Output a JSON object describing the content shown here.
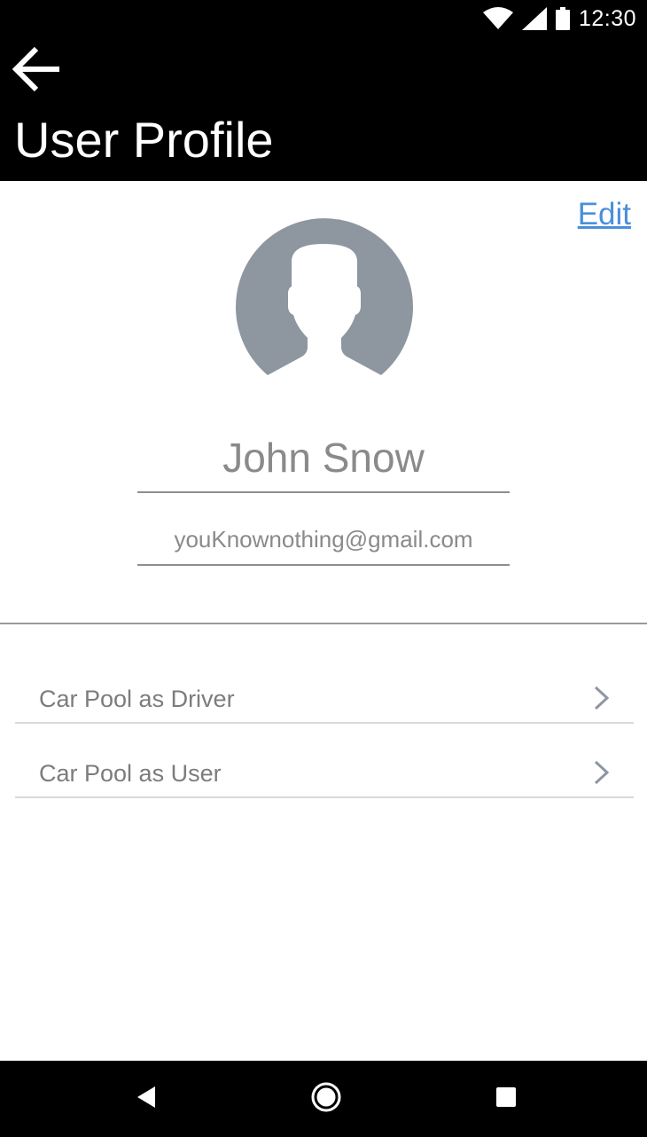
{
  "status_bar": {
    "time": "12:30",
    "icons": [
      "wifi-icon",
      "signal-icon",
      "battery-icon"
    ]
  },
  "app_bar": {
    "title": "User Profile",
    "back_icon": "arrow-left-icon"
  },
  "profile": {
    "edit_label": "Edit",
    "avatar_icon": "default-avatar-icon",
    "name": "John Snow",
    "email": "youKnownothing@gmail.com"
  },
  "menu": {
    "items": [
      {
        "label": "Car Pool as Driver",
        "icon": "chevron-right-icon"
      },
      {
        "label": "Car Pool as User",
        "icon": "chevron-right-icon"
      }
    ]
  },
  "nav_bar": {
    "buttons": [
      "back-triangle-icon",
      "home-circle-icon",
      "recents-square-icon"
    ]
  },
  "colors": {
    "app_bar_bg": "#000000",
    "link": "#4a90d9",
    "avatar": "#8e96a0",
    "text_secondary": "#8a8a8a"
  }
}
